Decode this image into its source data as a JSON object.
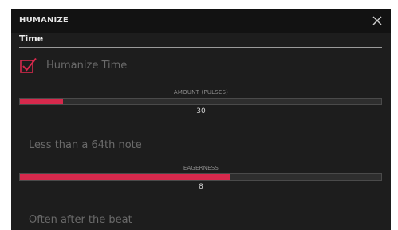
{
  "dialog": {
    "title": "HUMANIZE",
    "close_icon": "close-icon"
  },
  "section": {
    "title": "Time"
  },
  "humanize_time": {
    "label": "Humanize Time",
    "checked": true,
    "icon": "checkmark-icon",
    "accent_color": "#d6294c"
  },
  "amount": {
    "label": "AMOUNT (PULSES)",
    "value": "30",
    "fill_fraction": 0.12,
    "description": "Less than a 64th note"
  },
  "eagerness": {
    "label": "EAGERNESS",
    "value": "8",
    "fill_fraction": 0.58,
    "description": "Often after the beat"
  }
}
